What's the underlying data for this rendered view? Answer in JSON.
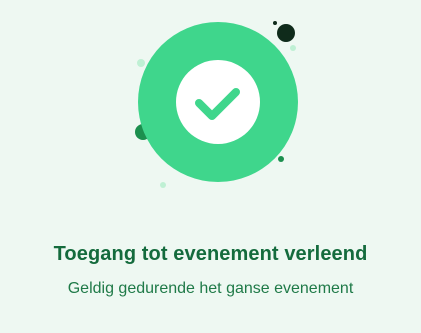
{
  "status": {
    "title": "Toegang tot evenement verleend",
    "subtitle": "Geldig gedurende het ganse evenement",
    "icon": "checkmark-icon"
  },
  "colors": {
    "background": "#eef8f2",
    "ring": "#3fd68c",
    "check": "#3fd68c",
    "title": "#146b3d",
    "subtitle": "#1f7a48",
    "dark_dot": "#0f2b1b",
    "green_dot": "#1c8f4e",
    "light_dot": "#bff0d4"
  }
}
